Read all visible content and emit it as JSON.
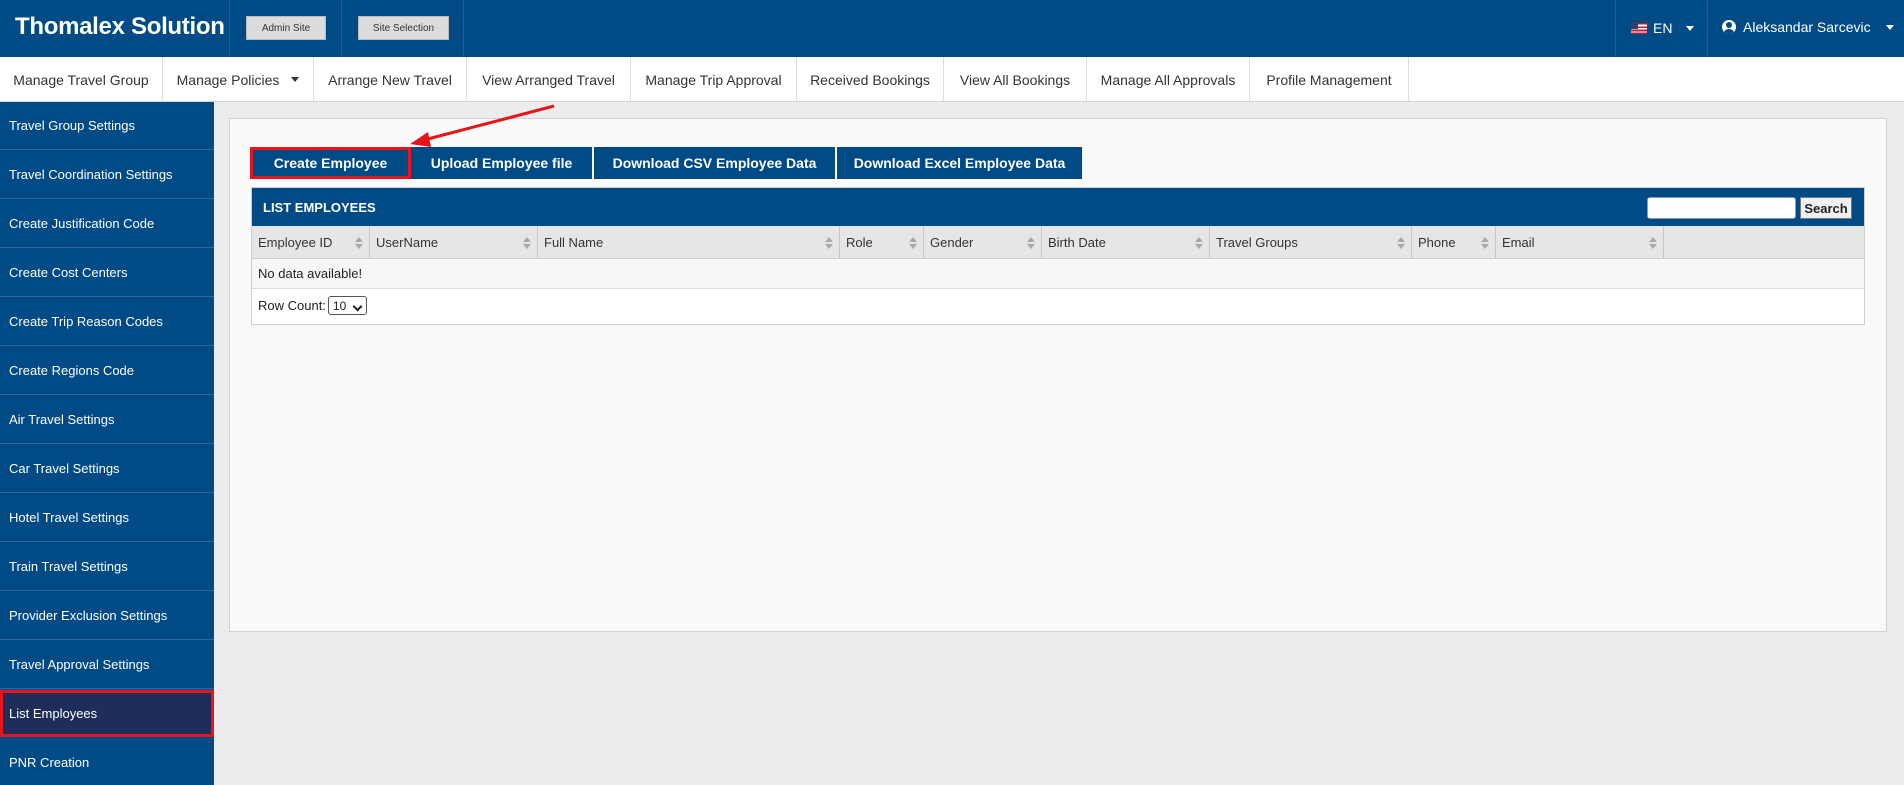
{
  "header": {
    "brand": "Thomalex Solution",
    "admin_site": "Admin Site",
    "site_selection": "Site Selection",
    "language": "EN",
    "user_name": "Aleksandar Sarcevic"
  },
  "menu": [
    {
      "label": "Manage Travel Group"
    },
    {
      "label": "Manage Policies",
      "has_dropdown": true
    },
    {
      "label": "Arrange New Travel"
    },
    {
      "label": "View Arranged Travel"
    },
    {
      "label": "Manage Trip Approval"
    },
    {
      "label": "Received Bookings"
    },
    {
      "label": "View All Bookings"
    },
    {
      "label": "Manage All Approvals"
    },
    {
      "label": "Profile Management"
    }
  ],
  "sidebar": {
    "items": [
      {
        "label": "Travel Group Settings"
      },
      {
        "label": "Travel Coordination Settings"
      },
      {
        "label": "Create Justification Code"
      },
      {
        "label": "Create Cost Centers"
      },
      {
        "label": "Create Trip Reason Codes"
      },
      {
        "label": "Create Regions Code"
      },
      {
        "label": "Air Travel Settings"
      },
      {
        "label": "Car Travel Settings"
      },
      {
        "label": "Hotel Travel Settings"
      },
      {
        "label": "Train Travel Settings"
      },
      {
        "label": "Provider Exclusion Settings"
      },
      {
        "label": "Travel Approval Settings"
      },
      {
        "label": "List Employees",
        "active": true
      },
      {
        "label": "PNR Creation"
      }
    ]
  },
  "actions": {
    "create": "Create Employee",
    "upload": "Upload Employee file",
    "download_csv": "Download CSV Employee Data",
    "download_excel": "Download Excel Employee Data"
  },
  "grid": {
    "title": "LIST EMPLOYEES",
    "search_label": "Search",
    "search_value": "",
    "columns": [
      "Employee ID",
      "UserName",
      "Full Name",
      "Role",
      "Gender",
      "Birth Date",
      "Travel Groups",
      "Phone",
      "Email"
    ],
    "empty_message": "No data available!",
    "row_count_label": "Row Count:",
    "row_count_value": "10"
  },
  "colors": {
    "primary": "#004a86",
    "active_sidebar": "#1e2d5a",
    "highlight": "#e8141c"
  }
}
